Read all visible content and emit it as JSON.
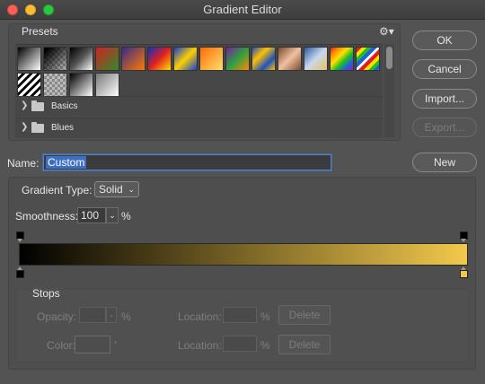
{
  "window": {
    "title": "Gradient Editor"
  },
  "presets": {
    "label": "Presets",
    "gear_icon": "gear-icon",
    "folders": [
      {
        "label": "Basics"
      },
      {
        "label": "Blues"
      }
    ]
  },
  "buttons": {
    "ok": "OK",
    "cancel": "Cancel",
    "import": "Import...",
    "export": "Export...",
    "new": "New"
  },
  "name": {
    "label": "Name:",
    "value": "Custom"
  },
  "gradient": {
    "type_label": "Gradient Type:",
    "type_value": "Solid",
    "smoothness_label": "Smoothness:",
    "smoothness_value": "100",
    "smoothness_unit": "%",
    "start_color": "#000000",
    "end_color": "#f2c94c"
  },
  "stops": {
    "label": "Stops",
    "opacity_label": "Opacity:",
    "opacity_unit": "%",
    "color_label": "Color:",
    "location_label": "Location:",
    "location_unit": "%",
    "delete_label": "Delete"
  }
}
